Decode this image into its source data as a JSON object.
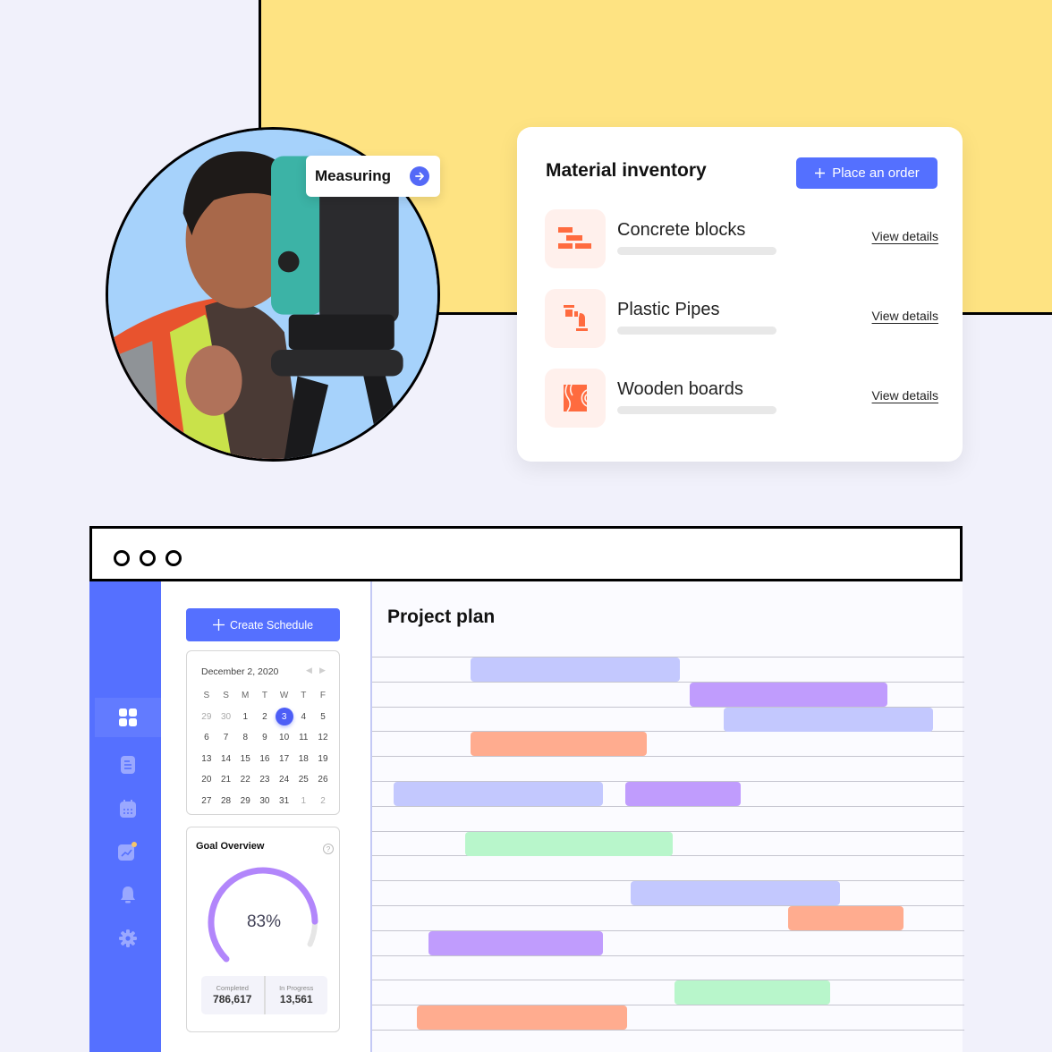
{
  "photo_card": {
    "chip_label": "Measuring",
    "chip_icon": "arrow-right-icon"
  },
  "inventory": {
    "title": "Material inventory",
    "order_button": "Place an order",
    "items": [
      {
        "name": "Concrete blocks",
        "icon": "brick-icon",
        "link": "View details"
      },
      {
        "name": "Plastic Pipes",
        "icon": "pipe-icon",
        "link": "View details"
      },
      {
        "name": "Wooden boards",
        "icon": "wood-icon",
        "link": "View details"
      }
    ]
  },
  "app": {
    "sidebar": [
      {
        "icon": "dashboard-icon",
        "active": true
      },
      {
        "icon": "document-icon",
        "active": false
      },
      {
        "icon": "calendar-icon",
        "active": false
      },
      {
        "icon": "analytics-icon",
        "active": false,
        "badge": true
      },
      {
        "icon": "bell-icon",
        "active": false
      },
      {
        "icon": "gear-icon",
        "active": false
      }
    ],
    "create_button": "Create Schedule",
    "calendar": {
      "title": "December 2, 2020",
      "weekdays": [
        "S",
        "S",
        "M",
        "T",
        "W",
        "T",
        "F"
      ],
      "days": [
        [
          "29",
          "30",
          "1",
          "2",
          "3",
          "4",
          "5"
        ],
        [
          "6",
          "7",
          "8",
          "9",
          "10",
          "11",
          "12"
        ],
        [
          "13",
          "14",
          "15",
          "16",
          "17",
          "18",
          "19"
        ],
        [
          "20",
          "21",
          "22",
          "23",
          "24",
          "25",
          "26"
        ],
        [
          "27",
          "28",
          "29",
          "30",
          "31",
          "1",
          "2"
        ]
      ],
      "muted": [
        "0-0",
        "0-1",
        "4-5",
        "4-6"
      ],
      "selected": "3"
    },
    "goal": {
      "title": "Goal Overview",
      "percent": 83,
      "percent_label": "83%",
      "completed_label": "Completed",
      "completed_value": "786,617",
      "in_progress_label": "In Progress",
      "in_progress_value": "13,561"
    },
    "project_plan": {
      "title": "Project plan",
      "colors": {
        "blue": "#c3c8fe",
        "purple": "#c09cfd",
        "orange": "#ffac8f",
        "green": "#b8f6cb"
      },
      "bars": [
        {
          "row": 0,
          "start": 0.166,
          "end": 0.52,
          "color": "blue"
        },
        {
          "row": 1,
          "start": 0.537,
          "end": 0.87,
          "color": "purple"
        },
        {
          "row": 2,
          "start": 0.593,
          "end": 0.947,
          "color": "blue"
        },
        {
          "row": 3,
          "start": 0.166,
          "end": 0.464,
          "color": "orange"
        },
        {
          "row": 5,
          "start": 0.036,
          "end": 0.389,
          "color": "blue"
        },
        {
          "row": 5,
          "start": 0.427,
          "end": 0.622,
          "color": "purple"
        },
        {
          "row": 7,
          "start": 0.157,
          "end": 0.507,
          "color": "green"
        },
        {
          "row": 9,
          "start": 0.437,
          "end": 0.79,
          "color": "blue"
        },
        {
          "row": 10,
          "start": 0.703,
          "end": 0.898,
          "color": "orange"
        },
        {
          "row": 11,
          "start": 0.095,
          "end": 0.389,
          "color": "purple"
        },
        {
          "row": 13,
          "start": 0.51,
          "end": 0.774,
          "color": "green"
        },
        {
          "row": 14,
          "start": 0.076,
          "end": 0.43,
          "color": "orange"
        }
      ],
      "rows": 15
    }
  }
}
